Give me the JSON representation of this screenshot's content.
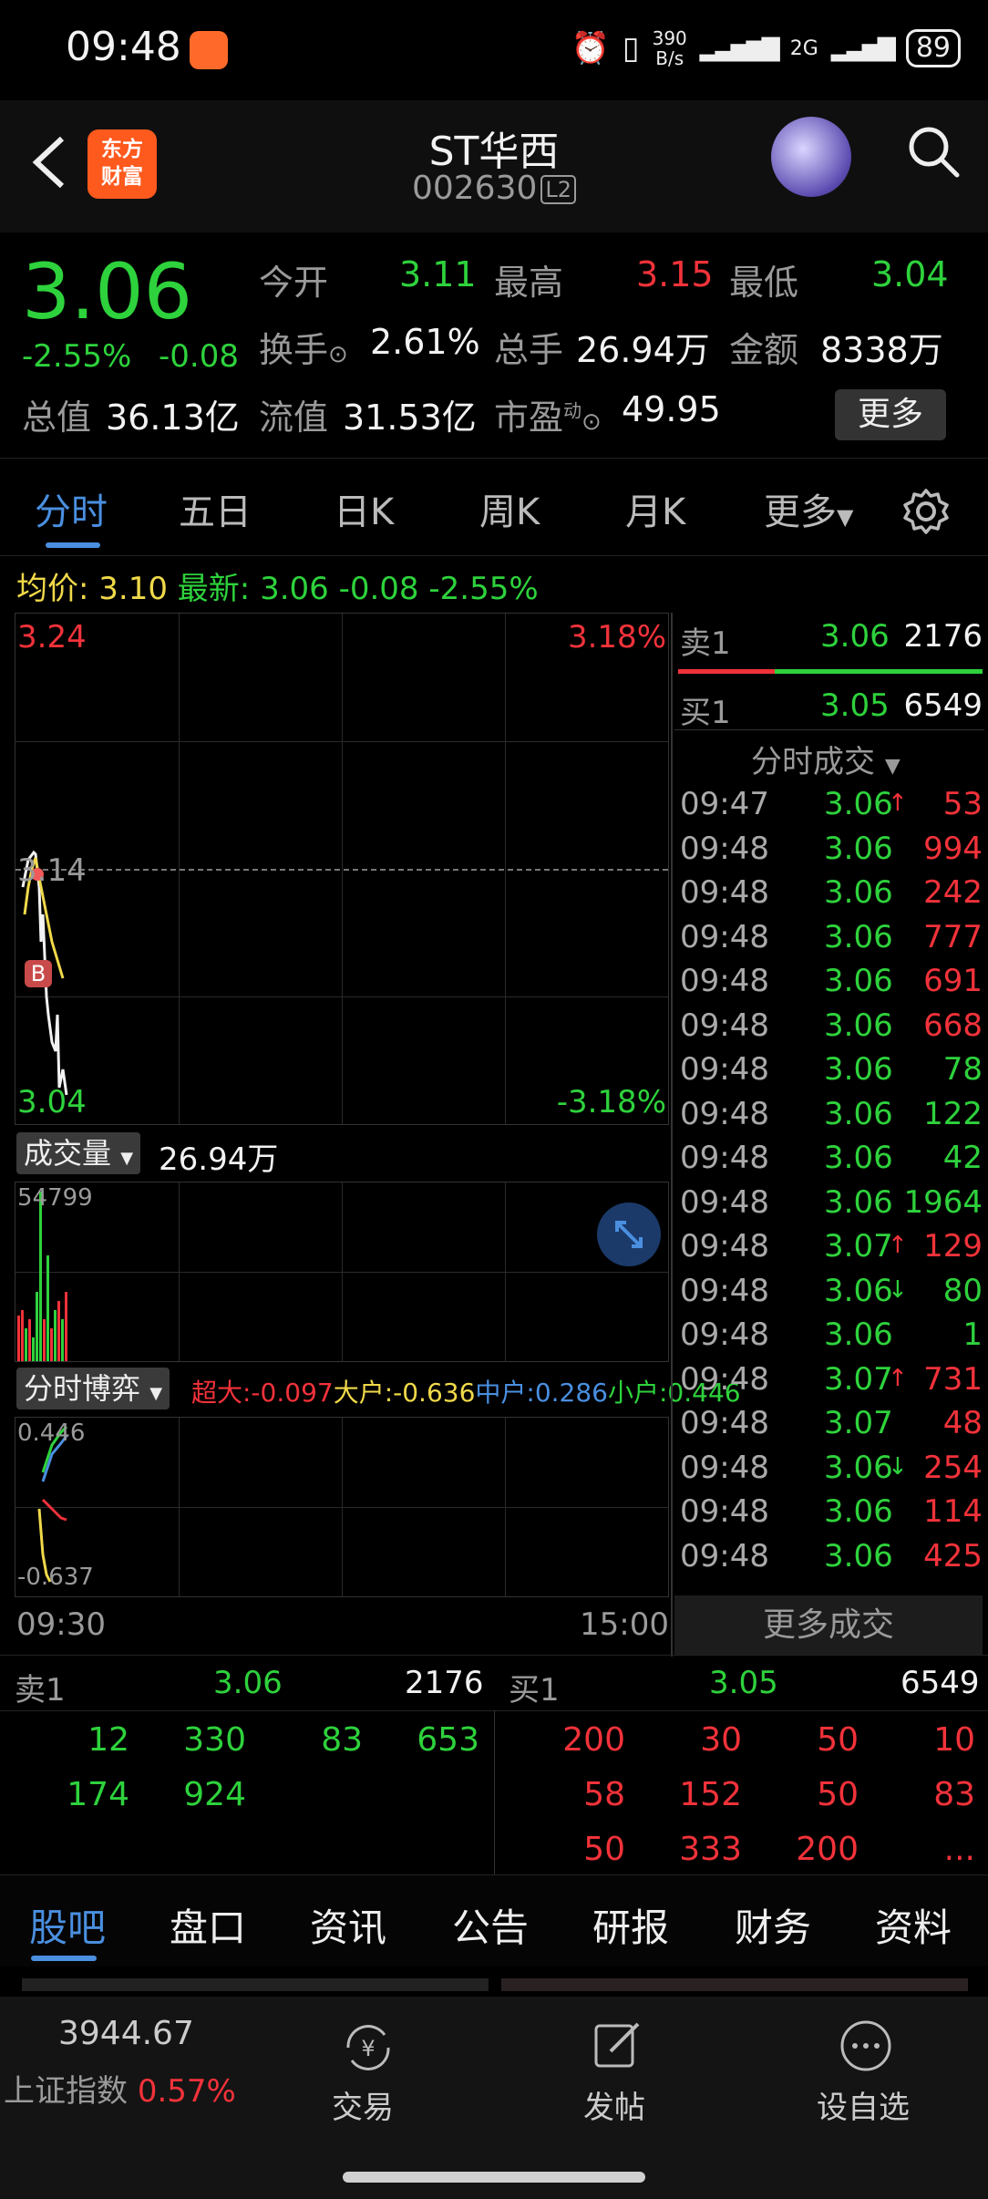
{
  "status_bar": {
    "time": "09:48",
    "net_speed_top": "390",
    "net_speed_unit": "B/s",
    "network": "2G",
    "battery": "89"
  },
  "header": {
    "logo_line1": "东方",
    "logo_line2": "财富",
    "title": "ST华西",
    "code": "002630",
    "level_badge": "L2"
  },
  "quote": {
    "price": "3.06",
    "change_pct": "-2.55%",
    "change": "-0.08",
    "open_label": "今开",
    "open": "3.11",
    "high_label": "最高",
    "high": "3.15",
    "low_label": "最低",
    "low": "3.04",
    "turnover_label": "换手",
    "turnover": "2.61%",
    "volume_label": "总手",
    "volume": "26.94万",
    "amount_label": "金额",
    "amount": "8338万",
    "mcap_label": "总值",
    "mcap": "36.13亿",
    "float_label": "流值",
    "float_cap": "31.53亿",
    "pe_label": "市盈",
    "pe_super": "动",
    "pe": "49.95",
    "more_label": "更多"
  },
  "tabs": [
    "分时",
    "五日",
    "日K",
    "周K",
    "月K",
    "更多"
  ],
  "avg_line": {
    "avg_label": "均价:",
    "avg": "3.10",
    "latest_label": "最新:",
    "latest": "3.06",
    "chg": "-0.08",
    "chg_pct": "-2.55%"
  },
  "chart": {
    "y_top": "3.24",
    "y_top_pct": "3.18%",
    "y_mid": "3.14",
    "y_bottom": "3.04",
    "y_bottom_pct": "-3.18%",
    "marker": "B",
    "volume_label": "成交量",
    "volume_value": "26.94万",
    "volume_max": "54799",
    "game_label": "分时博弈",
    "game_super": "超大:-0.097",
    "game_big": "大户:-0.636",
    "game_mid": "中户:0.286",
    "game_small": "小户:0.446",
    "game_top": "0.446",
    "game_bottom": "-0.637",
    "time_start": "09:30",
    "time_end": "15:00"
  },
  "book": {
    "sell1_label": "卖1",
    "sell1_price": "3.06",
    "sell1_vol": "2176",
    "buy1_label": "买1",
    "buy1_price": "3.05",
    "buy1_vol": "6549",
    "trades_title": "分时成交",
    "trades": [
      {
        "t": "09:47",
        "p": "3.06",
        "a": "↑",
        "v": "53",
        "pc": "green",
        "vc": "red",
        "ac": "red"
      },
      {
        "t": "09:48",
        "p": "3.06",
        "a": "",
        "v": "994",
        "pc": "green",
        "vc": "red",
        "ac": ""
      },
      {
        "t": "09:48",
        "p": "3.06",
        "a": "",
        "v": "242",
        "pc": "green",
        "vc": "red",
        "ac": ""
      },
      {
        "t": "09:48",
        "p": "3.06",
        "a": "",
        "v": "777",
        "pc": "green",
        "vc": "red",
        "ac": ""
      },
      {
        "t": "09:48",
        "p": "3.06",
        "a": "",
        "v": "691",
        "pc": "green",
        "vc": "red",
        "ac": ""
      },
      {
        "t": "09:48",
        "p": "3.06",
        "a": "",
        "v": "668",
        "pc": "green",
        "vc": "red",
        "ac": ""
      },
      {
        "t": "09:48",
        "p": "3.06",
        "a": "",
        "v": "78",
        "pc": "green",
        "vc": "green",
        "ac": ""
      },
      {
        "t": "09:48",
        "p": "3.06",
        "a": "",
        "v": "122",
        "pc": "green",
        "vc": "green",
        "ac": ""
      },
      {
        "t": "09:48",
        "p": "3.06",
        "a": "",
        "v": "42",
        "pc": "green",
        "vc": "green",
        "ac": ""
      },
      {
        "t": "09:48",
        "p": "3.06",
        "a": "",
        "v": "1964",
        "pc": "green",
        "vc": "green",
        "ac": ""
      },
      {
        "t": "09:48",
        "p": "3.07",
        "a": "↑",
        "v": "129",
        "pc": "green",
        "vc": "red",
        "ac": "red"
      },
      {
        "t": "09:48",
        "p": "3.06",
        "a": "↓",
        "v": "80",
        "pc": "green",
        "vc": "green",
        "ac": "green"
      },
      {
        "t": "09:48",
        "p": "3.06",
        "a": "",
        "v": "1",
        "pc": "green",
        "vc": "green",
        "ac": ""
      },
      {
        "t": "09:48",
        "p": "3.07",
        "a": "↑",
        "v": "731",
        "pc": "green",
        "vc": "red",
        "ac": "red"
      },
      {
        "t": "09:48",
        "p": "3.07",
        "a": "",
        "v": "48",
        "pc": "green",
        "vc": "red",
        "ac": ""
      },
      {
        "t": "09:48",
        "p": "3.06",
        "a": "↓",
        "v": "254",
        "pc": "green",
        "vc": "red",
        "ac": "green"
      },
      {
        "t": "09:48",
        "p": "3.06",
        "a": "",
        "v": "114",
        "pc": "green",
        "vc": "red",
        "ac": ""
      },
      {
        "t": "09:48",
        "p": "3.06",
        "a": "",
        "v": "425",
        "pc": "green",
        "vc": "red",
        "ac": ""
      }
    ],
    "more_trades": "更多成交"
  },
  "depth": {
    "sell_label": "卖1",
    "sell_price": "3.06",
    "sell_vol": "2176",
    "buy_label": "买1",
    "buy_price": "3.05",
    "buy_vol": "6549",
    "sell_rows": [
      [
        "12",
        "330",
        "83",
        "653"
      ],
      [
        "174",
        "924",
        "",
        ""
      ]
    ],
    "buy_rows": [
      [
        "200",
        "30",
        "50",
        "10"
      ],
      [
        "58",
        "152",
        "50",
        "83"
      ],
      [
        "50",
        "333",
        "200",
        "..."
      ]
    ]
  },
  "bottom_tabs": [
    "股吧",
    "盘口",
    "资讯",
    "公告",
    "研报",
    "财务",
    "资料"
  ],
  "nav": {
    "index_value": "3944.67",
    "index_name": "上证指数",
    "index_pct": "0.57%",
    "trade": "交易",
    "post": "发帖",
    "watch": "设自选"
  }
}
